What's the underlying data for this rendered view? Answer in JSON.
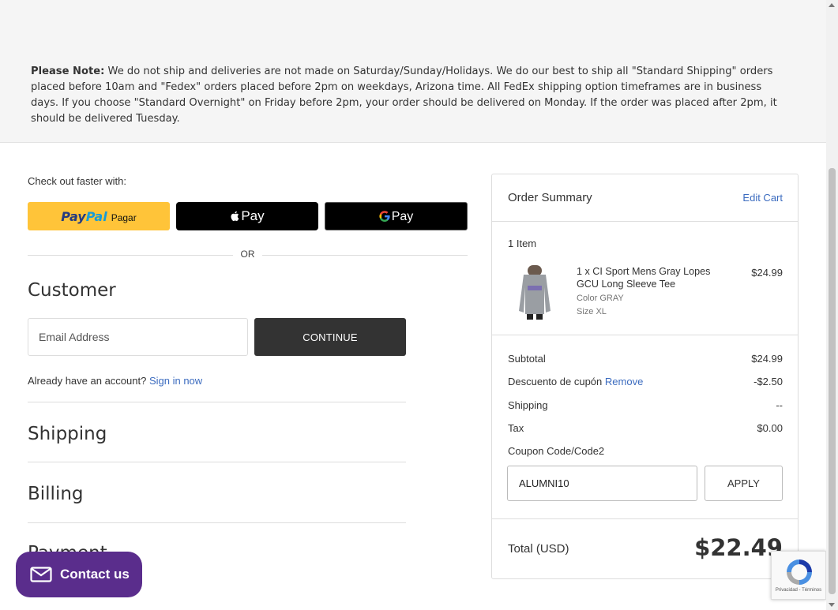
{
  "notice": {
    "label": "Please Note:",
    "text": " We do not ship and deliveries are not made on Saturday/Sunday/Holidays. We do our best to ship all \"Standard Shipping\" orders placed before 10am and \"Fedex\" orders placed before 2pm on weekdays, Arizona time. All FedEx shipping option timeframes are in business days. If you choose \"Standard Overnight\" on Friday before 2pm, your order should be delivered on Monday. If the order was placed after 2pm, it should be delivered Tuesday."
  },
  "express": {
    "label": "Check out faster with:",
    "paypal_pay": "Pay",
    "paypal_pal": "Pal",
    "paypal_text": "Pagar",
    "applepay_text": "Pay",
    "gpay_text": "Pay",
    "or": "OR"
  },
  "customer": {
    "title": "Customer",
    "email_placeholder": "Email Address",
    "continue_label": "CONTINUE",
    "account_prompt": "Already have an account?",
    "sign_in": "Sign in now"
  },
  "sections": {
    "shipping": "Shipping",
    "billing": "Billing",
    "payment": "Payment"
  },
  "summary": {
    "title": "Order Summary",
    "edit_cart": "Edit Cart",
    "item_count": "1 Item",
    "product": {
      "name": "1 x CI Sport Mens Gray Lopes GCU Long Sleeve Tee",
      "price": "$24.99",
      "color": "Color GRAY",
      "size": "Size XL"
    },
    "subtotal_label": "Subtotal",
    "subtotal_value": "$24.99",
    "discount_label": "Descuento de cupón",
    "discount_remove": "Remove",
    "discount_value": "-$2.50",
    "shipping_label": "Shipping",
    "shipping_value": "--",
    "tax_label": "Tax",
    "tax_value": "$0.00",
    "coupon_link": "Coupon Code/Code2",
    "coupon_value": "ALUMNI10",
    "apply_label": "APPLY",
    "total_label": "Total (USD)",
    "total_value": "$22.49"
  },
  "contact": {
    "label": "Contact us"
  },
  "recaptcha": {
    "text": "Privacidad - Términos"
  },
  "colors": {
    "accent_link": "#3b6bbf",
    "contact_purple": "#5a2d8c",
    "paypal_yellow": "#ffc439"
  }
}
